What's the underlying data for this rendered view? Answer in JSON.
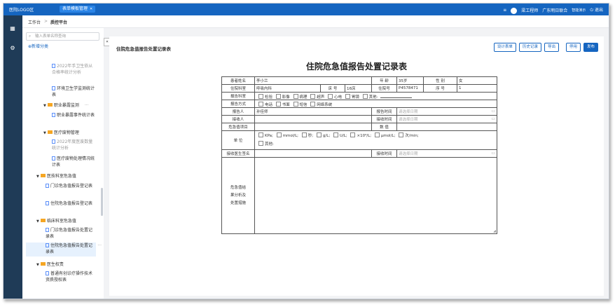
{
  "header": {
    "logo": "医院LOGO区",
    "active_tab": "表单模板管理",
    "user_name": "梁工程师",
    "org": "广东明日联合",
    "role": "智能演示",
    "logout": "退出"
  },
  "breadcrumb": {
    "home": "工作台",
    "sep": ">",
    "current": "质控平台"
  },
  "sidebar": {
    "search_placeholder": "输入表单名称查询",
    "add_category": "新增分类",
    "items": [
      {
        "label": "2022年手卫生依从合格率统计分析"
      },
      {
        "label": "环境卫生学监测统计表"
      },
      {
        "label": "职业暴露监测"
      },
      {
        "label": "职业暴露事件统计表"
      },
      {
        "label": "医疗废物管理"
      },
      {
        "label": "2022年度医废数量统计分析"
      },
      {
        "label": "医疗废物处理情况统计表"
      },
      {
        "label": "医技科室危急值"
      },
      {
        "label": "门诊危急值报告登记表"
      },
      {
        "label": "住院危急值报告登记表"
      },
      {
        "label": "临床科室危急值"
      },
      {
        "label": "门诊危急值报告处置记录表"
      },
      {
        "label": "住院危急值报告处置记录表"
      },
      {
        "label": "医生权责"
      },
      {
        "label": "普通有创诊疗操作技术资质授权表"
      }
    ]
  },
  "main": {
    "page_title": "住院危急值报告处置记录表",
    "buttons": {
      "design": "设计表单",
      "history": "历史记录",
      "export": "导出",
      "disable": "停用",
      "publish": "发布"
    }
  },
  "form": {
    "title": "住院危急值报告处置记录表",
    "labels": {
      "patient_name": "患者姓名",
      "age": "年 龄",
      "sex": "性 别",
      "dept": "住院科室",
      "bed": "床 号",
      "inpatient_no": "住院号",
      "seq_no": "序 号",
      "report_dept": "报告科室",
      "report_method": "报告方式",
      "reporter": "报告人",
      "report_time": "报告时间",
      "receiver": "接收人",
      "receive_time": "接收时间",
      "item": "危急值项目",
      "value": "数 值",
      "unit": "单 位",
      "doctor_sign": "接收医生签名",
      "doc_receive_time": "接收时间",
      "handling": "危急值结果分析及处置措施"
    },
    "values": {
      "patient_name": "李小兰",
      "age": "35岁",
      "sex": "女",
      "dept": "呼吸内科",
      "bed": "16床",
      "inpatient_no": "P4578471",
      "seq_no": "1",
      "reporter": "孙佳师"
    },
    "date_placeholder": "请选择日期",
    "report_dept_options": [
      "检验",
      "影像",
      "病理",
      "超声",
      "心电",
      "胃镜",
      "其他:"
    ],
    "report_method_options": [
      "电话",
      "书面",
      "短信",
      "网络系统"
    ],
    "unit_options": [
      "KPa;",
      "mmol/L;",
      "秒;",
      "g/L;",
      "U/L;",
      "×10⁹/L;",
      "μmol/L;",
      "次/min;",
      "其他:"
    ]
  }
}
